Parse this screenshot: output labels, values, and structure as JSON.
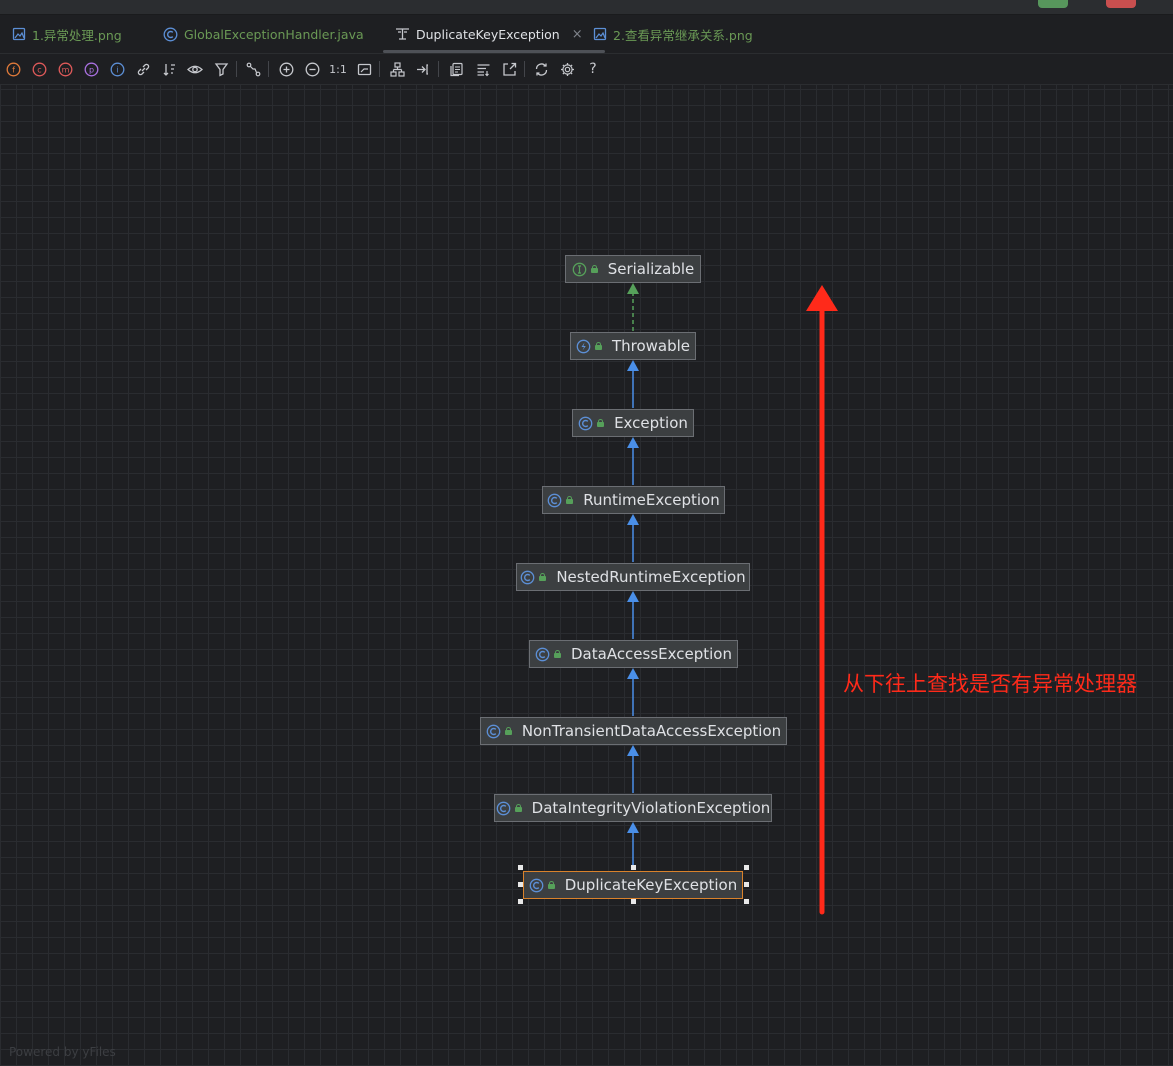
{
  "tabs": [
    {
      "label": "1.异常处理.png",
      "icon": "image-file-icon",
      "color": "#6a9955"
    },
    {
      "label": "GlobalExceptionHandler.java",
      "icon": "java-class-icon",
      "color": "#6a9955"
    },
    {
      "label": "DuplicateKeyException",
      "icon": "diagram-icon",
      "color": "#dfe1e5",
      "active": true,
      "close": "×"
    },
    {
      "label": "2.查看异常继承关系.png",
      "icon": "image-file-icon",
      "color": "#6a9955"
    }
  ],
  "toolbar": {
    "zoom_actual_label": "1:1",
    "help_label": "?"
  },
  "hierarchy": [
    {
      "name": "Serializable",
      "kind": "interface",
      "icon": "interface-icon"
    },
    {
      "name": "Throwable",
      "kind": "throwable",
      "icon": "throwable-class-icon"
    },
    {
      "name": "Exception",
      "kind": "class",
      "icon": "class-icon"
    },
    {
      "name": "RuntimeException",
      "kind": "class",
      "icon": "class-icon"
    },
    {
      "name": "NestedRuntimeException",
      "kind": "class",
      "icon": "class-icon"
    },
    {
      "name": "DataAccessException",
      "kind": "class",
      "icon": "class-icon"
    },
    {
      "name": "NonTransientDataAccessException",
      "kind": "class",
      "icon": "class-icon"
    },
    {
      "name": "DataIntegrityViolationException",
      "kind": "class",
      "icon": "class-icon"
    },
    {
      "name": "DuplicateKeyException",
      "kind": "class",
      "icon": "class-icon",
      "selected": true
    }
  ],
  "annotation": {
    "text": "从下往上查找是否有异常处理器",
    "color": "#ff2a1a"
  },
  "footer": {
    "powered_by": "Powered by yFiles"
  },
  "colors": {
    "background": "#1e1f22",
    "node_fill": "#3c3f41",
    "implements_edge": "#56a05a",
    "extends_edge": "#4a8fe8",
    "selection": "#d9822b",
    "annotation_arrow": "#ff2a1a"
  }
}
